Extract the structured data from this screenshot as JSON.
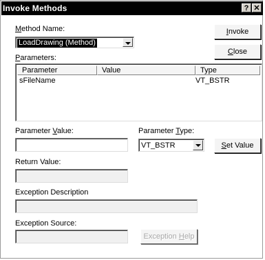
{
  "window": {
    "title": "Invoke Methods",
    "help_glyph": "?",
    "close_glyph": "✕"
  },
  "method": {
    "label_pre": "",
    "label_key": "M",
    "label_post": "ethod Name:",
    "value": "LoadDrawing (Method)"
  },
  "buttons": {
    "invoke_key": "I",
    "invoke_rest": "nvoke",
    "close_key": "C",
    "close_rest": "lose",
    "set_value_key": "S",
    "set_value_rest": "et Value",
    "exception_help_pre": "Exception ",
    "exception_help_key": "H",
    "exception_help_post": "elp"
  },
  "parameters": {
    "label_key": "P",
    "label_rest": "arameters:",
    "columns": [
      "Parameter",
      "Value",
      "Type"
    ],
    "rows": [
      {
        "parameter": "sFileName",
        "value": "",
        "type": "VT_BSTR"
      }
    ]
  },
  "parameter_value": {
    "label_pre": "Parameter ",
    "label_key": "V",
    "label_post": "alue:",
    "value": ""
  },
  "parameter_type": {
    "label_pre": "Parameter ",
    "label_key": "T",
    "label_post": "ype:",
    "value": "VT_BSTR"
  },
  "return_value": {
    "label": "Return Value:",
    "value": ""
  },
  "exception_description": {
    "label": "Exception Description",
    "value": ""
  },
  "exception_source": {
    "label": "Exception Source:",
    "value": ""
  }
}
